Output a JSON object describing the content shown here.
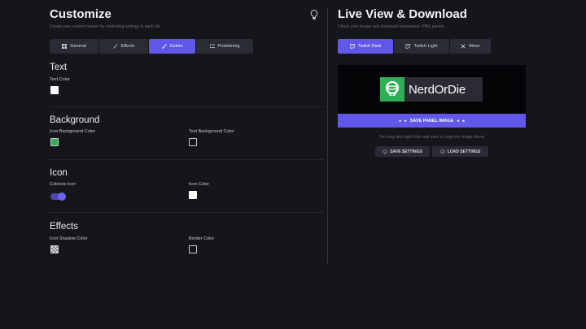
{
  "customize": {
    "title": "Customize",
    "subtitle": "Create your custom banner by controlling settings in each tab",
    "lightbulb_icon": "lightbulb-icon",
    "tabs": [
      {
        "label": "General",
        "icon": "grid-icon",
        "active": false
      },
      {
        "label": "Effects",
        "icon": "magic-wand-icon",
        "active": false
      },
      {
        "label": "Colors",
        "icon": "brush-icon",
        "active": true
      },
      {
        "label": "Positioning",
        "icon": "list-icon",
        "active": false
      }
    ],
    "text_section": {
      "title": "Text",
      "text_color_label": "Text Color",
      "text_color": "#ffffff"
    },
    "background_section": {
      "title": "Background",
      "icon_bg_label": "Icon Background Color",
      "icon_bg_color": "#2fae55",
      "text_bg_label": "Text Background Color"
    },
    "icon_section": {
      "title": "Icon",
      "colorize_label": "Colorize Icon",
      "colorize_on": true,
      "icon_color_label": "Icon Color",
      "icon_color": "#ffffff"
    },
    "effects_section": {
      "title": "Effects",
      "shadow_label": "Icon Shadow Color",
      "border_label": "Border Color"
    }
  },
  "live_view": {
    "title": "Live View & Download",
    "subtitle": "Check your design and download transparent .PNG panels",
    "tabs": [
      {
        "label": "Twitch Dark",
        "icon": "twitch-icon",
        "active": true
      },
      {
        "label": "Twitch Light",
        "icon": "twitch-icon",
        "active": false
      },
      {
        "label": "Mixer",
        "icon": "mixer-icon",
        "active": false
      }
    ],
    "banner_name": "NerdOrDie",
    "save_panel_label": "SAVE PANEL IMAGE",
    "note": "You may also right click and save or copy the image above",
    "save_settings_label": "SAVE SETTINGS",
    "load_settings_label": "LOAD SETTINGS"
  },
  "colors": {
    "accent": "#6157e8",
    "green": "#2fae55",
    "background": "#15161a"
  }
}
